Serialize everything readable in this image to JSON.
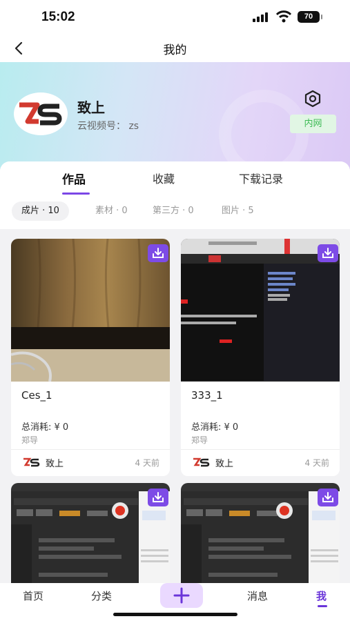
{
  "status_bar": {
    "time": "15:02",
    "battery": "70"
  },
  "nav": {
    "title": "我的",
    "back_icon": "chevron-left-icon"
  },
  "profile": {
    "name": "致上",
    "id_label": "云视频号：",
    "id_value": "zs",
    "settings_icon": "hexagon-settings-icon",
    "badge": "内网",
    "badge_color": "#3dbb55"
  },
  "tabs": [
    {
      "label": "作品",
      "active": true
    },
    {
      "label": "收藏",
      "active": false
    },
    {
      "label": "下载记录",
      "active": false
    }
  ],
  "filters": [
    {
      "label": "成片 · 10",
      "active": true
    },
    {
      "label": "素材 · 0",
      "active": false
    },
    {
      "label": "第三方 · 0",
      "active": false
    },
    {
      "label": "图片 · 5",
      "active": false
    }
  ],
  "cards": [
    {
      "title": "Ces_1",
      "cost": "总消耗: ¥ 0",
      "owner": "郑导",
      "author": "致上",
      "time": "4 天前"
    },
    {
      "title": "333_1",
      "cost": "总消耗: ¥ 0",
      "owner": "郑导",
      "author": "致上",
      "time": "4 天前"
    }
  ],
  "tabbar": {
    "home": "首页",
    "category": "分类",
    "messages": "消息",
    "me": "我",
    "add_icon": "plus-icon"
  },
  "colors": {
    "accent": "#7b46e6",
    "download": "#7d4be6"
  }
}
